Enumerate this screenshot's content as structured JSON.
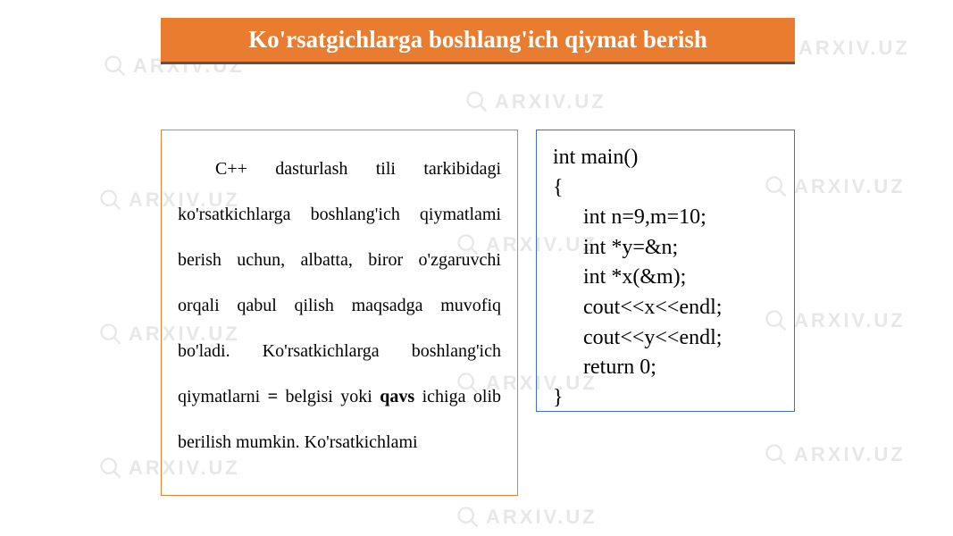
{
  "watermark": {
    "text": "ARXIV.UZ"
  },
  "header": {
    "title": "Ko'rsatgichlarga boshlang'ich qiymat berish"
  },
  "leftBox": {
    "para_prefix": "C++ dasturlash tili tarkibidagi ko'rsatkichlarga boshlang'ich qiymatlami berish uchun, albatta, biror o'zgaruvchi orqali qabul qilish maqsadga muvofiq bo'ladi. Ko'rsatkichlarga boshlang'ich qiymatlarni ",
    "bold1": "=",
    "mid1": " belgisi yoki ",
    "bold2": "qavs",
    "suffix": " ichiga olib berilish mumkin. Ko'rsatkichlami"
  },
  "code": {
    "l1": "int main()",
    "l2": "{",
    "l3": "int n=9,m=10;",
    "l4": "int *y=&n;",
    "l5": "int *x(&m);",
    "l6": "cout<<x<<endl;",
    "l7": "cout<<y<<endl;",
    "l8": "return 0;",
    "l9": "}"
  }
}
